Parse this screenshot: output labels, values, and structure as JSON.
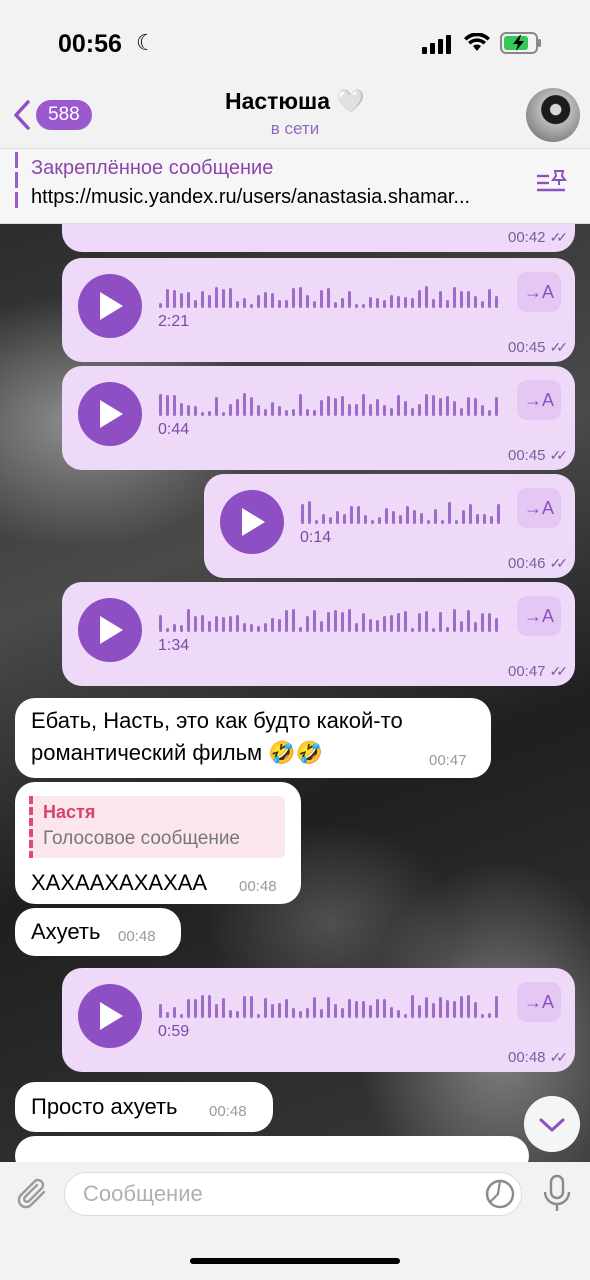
{
  "status_bar": {
    "time": "00:56"
  },
  "header": {
    "back_count": "588",
    "chat_name": "Настюша 🤍",
    "chat_status": "в сети"
  },
  "pinned": {
    "title": "Закреплённое сообщение",
    "text": "https://music.yandex.ru/users/anastasia.shamar..."
  },
  "messages": {
    "partial_top": {
      "time": "00:42"
    },
    "voice1": {
      "duration": "2:21",
      "time": "00:45",
      "translate": "→A"
    },
    "voice2": {
      "duration": "0:44",
      "time": "00:45",
      "translate": "→A"
    },
    "voice3": {
      "duration": "0:14",
      "time": "00:46",
      "translate": "→A"
    },
    "voice4": {
      "duration": "1:34",
      "time": "00:47",
      "translate": "→A"
    },
    "text1": {
      "text_line1": "Ебать, Насть, это как будто какой-то",
      "text_line2": "романтический фильм 🤣🤣",
      "time": "00:47"
    },
    "reply": {
      "quote_name": "Настя",
      "quote_text": "Голосовое сообщение",
      "text": "ХАХААХАХАХАА",
      "time": "00:48"
    },
    "text2": {
      "text": "Ахуеть",
      "time": "00:48"
    },
    "voice5": {
      "duration": "0:59",
      "time": "00:48",
      "translate": "→A"
    },
    "text3": {
      "text": "Просто ахуеть",
      "time": "00:48"
    }
  },
  "composer": {
    "placeholder": "Сообщение"
  },
  "colors": {
    "accent": "#8f4fc4",
    "bubble_out": "#efd9f9",
    "bubble_in": "#ffffff"
  }
}
